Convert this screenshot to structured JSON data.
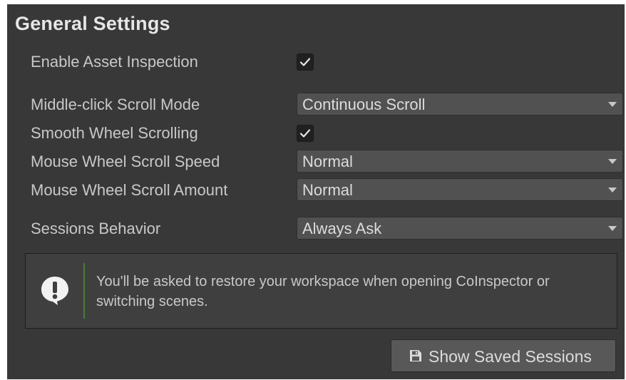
{
  "section": {
    "title": "General Settings"
  },
  "settings": {
    "enable_asset_inspection": {
      "label": "Enable Asset Inspection",
      "checked": true
    },
    "middle_click_scroll_mode": {
      "label": "Middle-click Scroll Mode",
      "value": "Continuous Scroll"
    },
    "smooth_wheel_scrolling": {
      "label": "Smooth Wheel Scrolling",
      "checked": true
    },
    "mouse_wheel_scroll_speed": {
      "label": "Mouse Wheel Scroll Speed",
      "value": "Normal"
    },
    "mouse_wheel_scroll_amount": {
      "label": "Mouse Wheel Scroll Amount",
      "value": "Normal"
    },
    "sessions_behavior": {
      "label": "Sessions Behavior",
      "value": "Always Ask"
    }
  },
  "help": {
    "icon": "info-exclamation-icon",
    "text": "You'll be asked to restore your workspace when opening CoInspector or switching scenes."
  },
  "show_saved_sessions": {
    "label": "Show Saved Sessions",
    "icon": "save-disk-icon"
  },
  "colors": {
    "panel_bg": "#383838",
    "text": "#c8c8c8",
    "dropdown_bg": "#515151",
    "help_accent": "#4c7a3a"
  }
}
